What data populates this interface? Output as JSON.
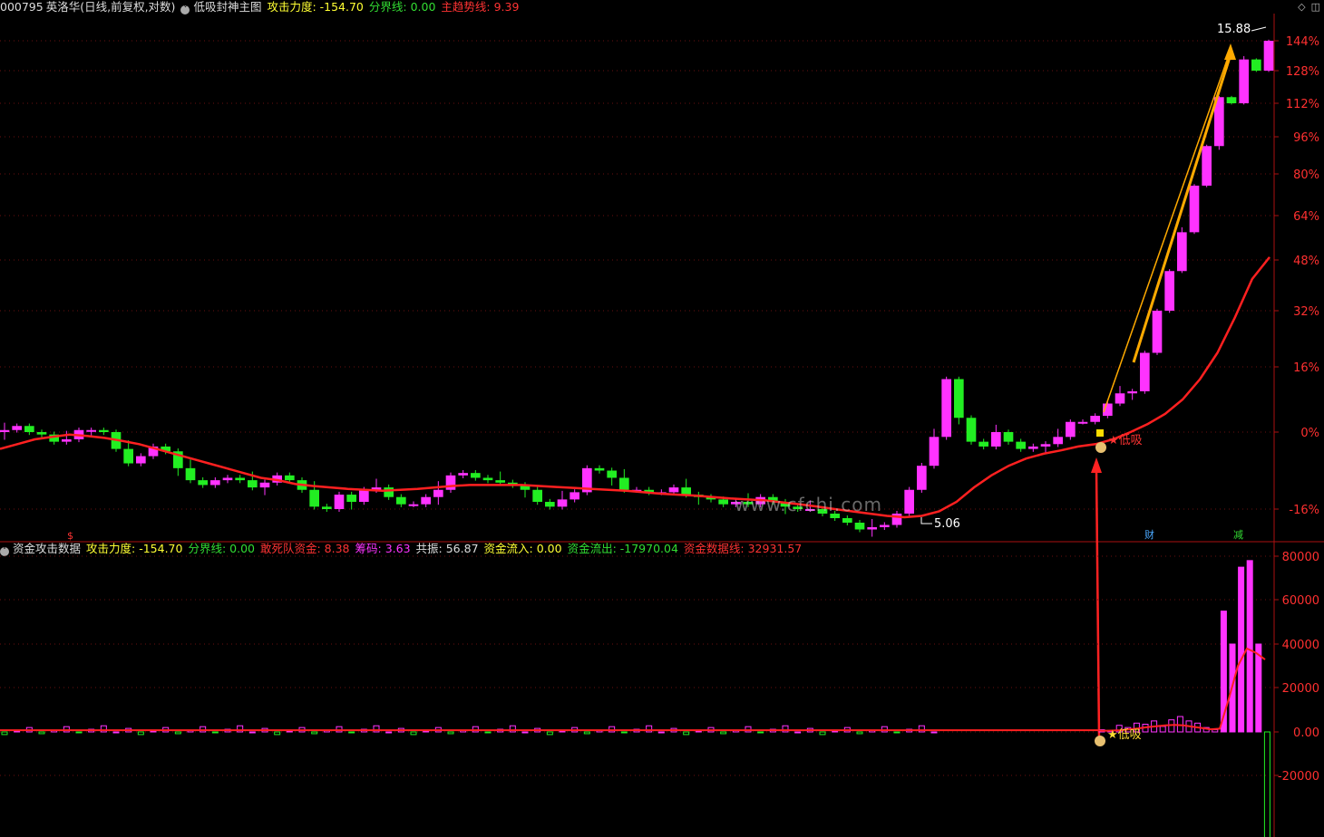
{
  "main_header": {
    "code": "000795",
    "name": "英洛华",
    "period": "(日线,前复权,对数)",
    "indicator_name": "低吸封神主图",
    "items": [
      {
        "label": "攻击力度:",
        "value": "-154.70",
        "color": "#ffff33"
      },
      {
        "label": "分界线:",
        "value": "0.00",
        "color": "#33dd33"
      },
      {
        "label": "主趋势线:",
        "value": "9.39",
        "color": "#ff3333"
      }
    ]
  },
  "sub_header": {
    "indicator_name": "资金攻击数据",
    "items": [
      {
        "label": "攻击力度:",
        "value": "-154.70",
        "color": "#ffff33"
      },
      {
        "label": "分界线:",
        "value": "0.00",
        "color": "#33dd33"
      },
      {
        "label": "敢死队资金:",
        "value": "8.38",
        "color": "#ff3333"
      },
      {
        "label": "筹码:",
        "value": "3.63",
        "color": "#ff33ff"
      },
      {
        "label": "共振:",
        "value": "56.87",
        "color": "#dddddd"
      },
      {
        "label": "资金流入:",
        "value": "0.00",
        "color": "#ffff33"
      },
      {
        "label": "资金流出:",
        "value": "-17970.04",
        "color": "#33dd33"
      },
      {
        "label": "资金数据线:",
        "value": "32931.57",
        "color": "#ff3333"
      }
    ]
  },
  "annotations": {
    "high_price": "15.88",
    "low_price": "5.06",
    "buy_label_main": "★低吸",
    "buy_label_sub": "★低吸",
    "marker_cai": "财",
    "marker_jian": "减",
    "marker_dollar": "$"
  },
  "watermark": "www.cfchi.com",
  "colors": {
    "up": "#ff33ff",
    "down": "#22ee22",
    "trend": "#ff2020",
    "arrow_up": "#ffaa00",
    "grid": "#6a1010",
    "axis_text": "#ff3030"
  },
  "chart_data": [
    {
      "type": "candlestick",
      "title": "",
      "y_axis_labels": [
        "144%",
        "128%",
        "112%",
        "96%",
        "80%",
        "64%",
        "48%",
        "32%",
        "16%",
        "0%",
        "-16%"
      ],
      "ticks": [
        144,
        128,
        112,
        96,
        80,
        64,
        48,
        32,
        16,
        0,
        -16
      ],
      "series_trend_name": "主趋势线",
      "closes_pct": [
        0.5,
        1.5,
        0.0,
        -0.5,
        -2.0,
        -1.5,
        0.5,
        0.5,
        0.0,
        -3.5,
        -6.5,
        -5.0,
        -3.0,
        -4.0,
        -7.5,
        -10.0,
        -11.0,
        -10.0,
        -9.5,
        -10.0,
        -11.5,
        -10.5,
        -9.0,
        -10.0,
        -12.0,
        -15.5,
        -16.0,
        -13.0,
        -14.5,
        -12.0,
        -11.5,
        -13.5,
        -15.0,
        -15.0,
        -13.5,
        -12.0,
        -9.0,
        -8.5,
        -9.5,
        -10.0,
        -10.5,
        -11.0,
        -12.0,
        -14.5,
        -15.5,
        -14.0,
        -12.5,
        -7.5,
        -8.0,
        -9.5,
        -12.0,
        -12.0,
        -12.5,
        -12.5,
        -11.5,
        -13.0,
        -13.5,
        -14.0,
        -15.0,
        -14.5,
        -15.0,
        -13.5,
        -14.5,
        -15.5,
        -16.0,
        -16.0,
        -17.0,
        -18.0,
        -19.0,
        -20.5,
        -20.0,
        -19.5,
        -17.0,
        -12.0,
        -7.0,
        -1.0,
        13.0,
        3.5,
        -2.0,
        -3.0,
        0.0,
        -2.0,
        -3.5,
        -3.0,
        -2.5,
        -1.0,
        2.5,
        2.5,
        4.0,
        7.0,
        9.5,
        10.0,
        20.0,
        32.0,
        44.5,
        58.0,
        75.5,
        92.0,
        115.0,
        112.0,
        134.0,
        128.0,
        144.0
      ],
      "trend_pct": [
        -3.5,
        -2.5,
        -1.5,
        -1.0,
        -0.5,
        -0.8,
        -1.2,
        -1.8,
        -2.5,
        -3.5,
        -4.5,
        -5.5,
        -6.5,
        -7.5,
        -8.5,
        -9.5,
        -10.0,
        -10.8,
        -11.2,
        -11.5,
        -11.8,
        -12.0,
        -12.2,
        -12.0,
        -11.8,
        -11.5,
        -11.2,
        -11.0,
        -11.0,
        -11.0,
        -11.0,
        -11.2,
        -11.4,
        -11.6,
        -11.8,
        -12.0,
        -12.2,
        -12.5,
        -12.8,
        -13.0,
        -13.2,
        -13.5,
        -13.8,
        -14.0,
        -14.2,
        -14.6,
        -15.0,
        -15.5,
        -16.0,
        -16.5,
        -17.0,
        -17.5,
        -17.8,
        -17.5,
        -16.5,
        -14.5,
        -11.5,
        -9.0,
        -7.0,
        -5.5,
        -4.5,
        -3.8,
        -3.0,
        -2.5,
        -1.5,
        0.0,
        2.0,
        4.5,
        8.0,
        13.0,
        20.0,
        30.0,
        42.0,
        49.0
      ]
    },
    {
      "type": "bar",
      "title": "",
      "y_axis_labels": [
        "80000",
        "60000",
        "40000",
        "20000",
        "0.00",
        "-20000"
      ],
      "ticks": [
        80000,
        60000,
        40000,
        20000,
        0,
        -20000
      ],
      "series_line_name": "资金数据线",
      "late_values": [
        1000,
        500,
        3000,
        2000,
        4000,
        3500,
        5000,
        2500,
        5500,
        7000,
        5000,
        4000,
        2000,
        1000,
        55000,
        40000,
        75000,
        78000,
        40000,
        -50000
      ],
      "late_line": [
        500,
        600,
        800,
        1200,
        1600,
        2200,
        2600,
        3000,
        3200,
        3000,
        2400,
        1800,
        1200,
        1500,
        15000,
        30000,
        38000,
        36000,
        32931
      ]
    }
  ]
}
